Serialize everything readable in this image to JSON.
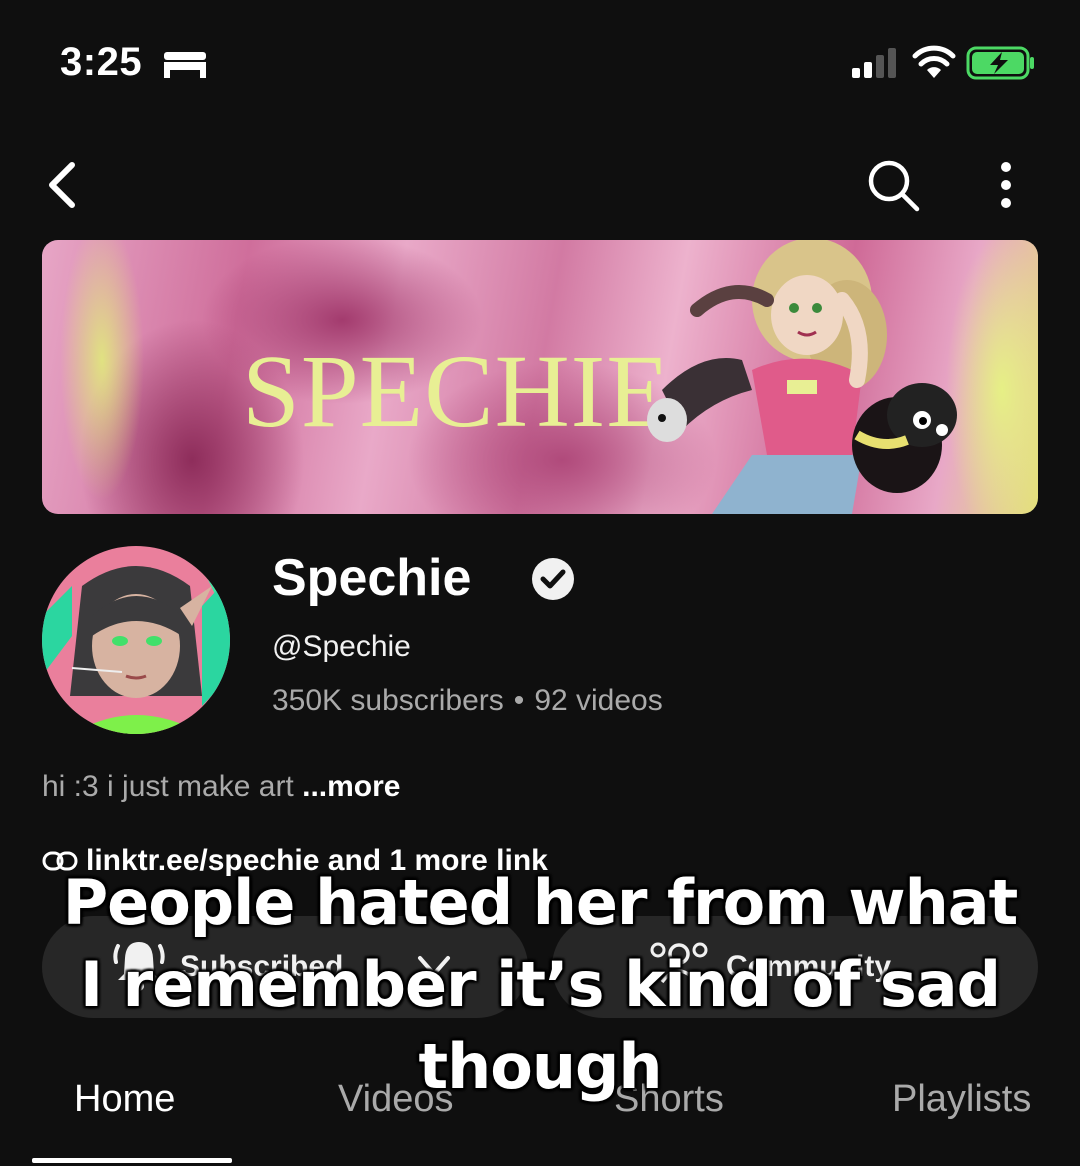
{
  "status_bar": {
    "time": "3:25",
    "icons": [
      "bed-icon",
      "signal-icon",
      "wifi-icon",
      "battery-charging-icon"
    ],
    "battery_color": "#4cd964"
  },
  "topbar": {
    "icons": [
      "back-icon",
      "search-icon",
      "more-vertical-icon"
    ]
  },
  "banner": {
    "title": "SPECHIE"
  },
  "channel": {
    "name": "Spechie",
    "handle": "@Spechie",
    "subscribers": "350K subscribers",
    "separator": "•",
    "videos": "92 videos"
  },
  "description": {
    "text": "hi :3 i just make art ",
    "more": "...more"
  },
  "links": {
    "text": "linktr.ee/spechie and 1 more link"
  },
  "actions": {
    "subscribe_label": "Subscribed",
    "community_label": "Community"
  },
  "tabs": [
    {
      "label": "Home",
      "active": true
    },
    {
      "label": "Videos",
      "active": false
    },
    {
      "label": "Shorts",
      "active": false
    },
    {
      "label": "Playlists",
      "active": false
    }
  ],
  "overlay_caption": {
    "line1": "People hated her from what",
    "line2": "I remember it’s kind of sad",
    "line3": "though"
  },
  "colors": {
    "background": "#0f0f0f",
    "button_bg": "#272727",
    "secondary_text": "#aaaaaa",
    "banner_title": "#e8ef94"
  }
}
